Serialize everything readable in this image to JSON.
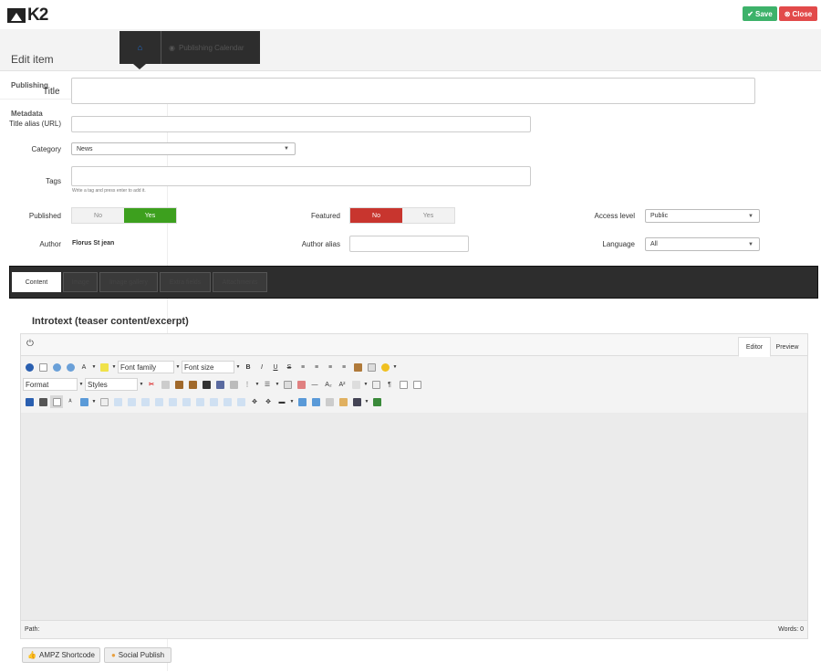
{
  "app": {
    "logo_text": "K2"
  },
  "toolbar": {
    "save_label": "Save",
    "close_label": "Close",
    "save_color": "#3db26a",
    "close_color": "#e24a4a"
  },
  "header": {
    "title": "Edit item",
    "tab_home_icon": "home-icon",
    "tab2_label": "Publishing Calendar"
  },
  "sidebar": {
    "items": [
      {
        "label": "Publishing"
      },
      {
        "label": "Metadata"
      }
    ]
  },
  "form": {
    "title_label": "Title",
    "title_value": "",
    "alias_label": "Title alias (URL)",
    "alias_value": "",
    "category_label": "Category",
    "category_value": "News",
    "tags_label": "Tags",
    "tags_hint": "Write a tag and press enter to add it.",
    "published_label": "Published",
    "published_no": "No",
    "published_yes": "Yes",
    "published_value": "Yes",
    "featured_label": "Featured",
    "featured_no": "No",
    "featured_yes": "Yes",
    "featured_value": "No",
    "access_label": "Access level",
    "access_value": "Public",
    "author_label": "Author",
    "author_value": "Florus St jean",
    "alias_author_label": "Author alias",
    "alias_author_value": "",
    "language_label": "Language",
    "language_value": "All"
  },
  "content_tabs": [
    {
      "label": "Content",
      "active": true
    },
    {
      "label": "Image",
      "active": false
    },
    {
      "label": "Image gallery",
      "active": false
    },
    {
      "label": "Extra fields",
      "active": false
    },
    {
      "label": "Attachments",
      "active": false
    }
  ],
  "editor": {
    "section_title": "Introtext (teaser content/excerpt)",
    "tab_editor": "Editor",
    "tab_preview": "Preview",
    "font_family": "Font family",
    "font_size": "Font size",
    "format": "Format",
    "styles": "Styles",
    "path_label": "Path:",
    "words_label": "Words: 0"
  },
  "buttons": {
    "ampz": "AMPZ Shortcode",
    "social": "Social Publish"
  }
}
